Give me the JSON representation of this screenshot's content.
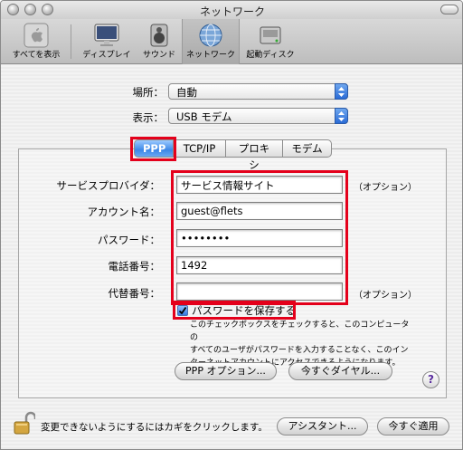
{
  "window": {
    "title": "ネットワーク"
  },
  "toolbar": {
    "items": [
      {
        "label": "すべてを表示",
        "icon": "apple-logo-icon"
      },
      {
        "label": "ディスプレイ",
        "icon": "display-icon"
      },
      {
        "label": "サウンド",
        "icon": "speaker-icon"
      },
      {
        "label": "ネットワーク",
        "icon": "network-globe-icon"
      },
      {
        "label": "起動ディスク",
        "icon": "hard-disk-icon"
      }
    ]
  },
  "location": {
    "label": "場所：",
    "value": "自動"
  },
  "show": {
    "label": "表示：",
    "value": "USB モデム"
  },
  "tabs": [
    {
      "label": "PPP",
      "active": true
    },
    {
      "label": "TCP/IP",
      "active": false
    },
    {
      "label": "プロキシ",
      "active": false
    },
    {
      "label": "モデム",
      "active": false
    }
  ],
  "form": {
    "provider": {
      "label": "サービスプロバイダ：",
      "value": "サービス情報サイト",
      "note": "（オプション）"
    },
    "account": {
      "label": "アカウント名：",
      "value": "guest@flets"
    },
    "password": {
      "label": "パスワード：",
      "value": "••••••••"
    },
    "phone": {
      "label": "電話番号：",
      "value": "1492"
    },
    "alt_phone": {
      "label": "代替番号：",
      "value": "",
      "note": "（オプション）"
    }
  },
  "save_password": {
    "label": "パスワードを保存する",
    "checked": true,
    "help_line1": "このチェックボックスをチェックすると、このコンピュータの",
    "help_line2": "すべてのユーザがパスワードを入力することなく、このイン",
    "help_line3": "ターネットアカウントにアクセスできるようになります。"
  },
  "buttons": {
    "ppp_options": "PPP オプション...",
    "dial_now": "今すぐダイヤル...",
    "help": "?",
    "assistant": "アシスタント...",
    "apply_now": "今すぐ適用"
  },
  "footer": {
    "lock_text": "変更できないようにするにはカギをクリックします。"
  },
  "colors": {
    "highlight": "#e4001b",
    "accent": "#3d87e6"
  }
}
